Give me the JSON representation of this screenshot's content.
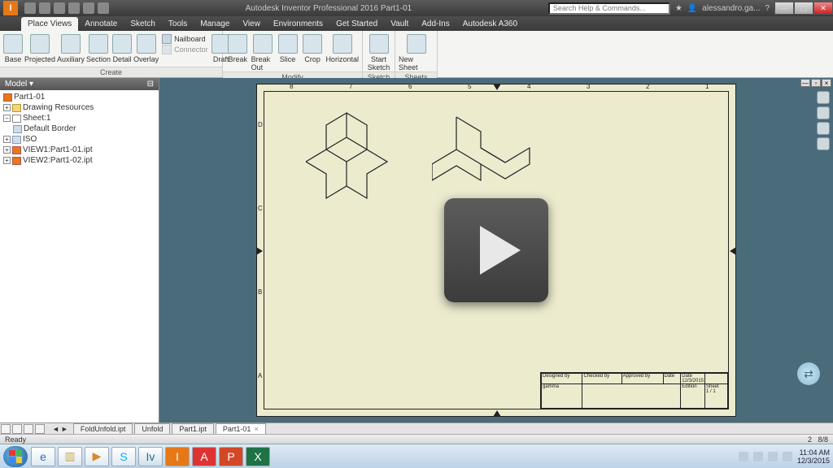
{
  "title": "Autodesk Inventor Professional 2016   Part1-01",
  "search_placeholder": "Search Help & Commands...",
  "user": "alessandro.ga...",
  "tabs": [
    "Place Views",
    "Annotate",
    "Sketch",
    "Tools",
    "Manage",
    "View",
    "Environments",
    "Get Started",
    "Vault",
    "Add-Ins",
    "Autodesk A360"
  ],
  "active_tab": 0,
  "ribbon": {
    "create": {
      "label": "Create",
      "big": [
        "Base",
        "Projected",
        "Auxiliary",
        "Section",
        "Detail",
        "Overlay"
      ],
      "side": [
        "Nailboard",
        "Connector"
      ],
      "draft": "Draft"
    },
    "modify": {
      "label": "Modify",
      "big": [
        "Break",
        "Break Out",
        "Slice",
        "Crop"
      ],
      "horizontal": "Horizontal"
    },
    "sketch": {
      "label": "Sketch",
      "btn": "Start\nSketch"
    },
    "sheets": {
      "label": "Sheets",
      "btn": "New Sheet"
    }
  },
  "browser": {
    "title": "Model ▾",
    "root": "Part1-01",
    "nodes": [
      {
        "label": "Drawing Resources",
        "icon": "folder",
        "indent": 1,
        "exp": "+"
      },
      {
        "label": "Sheet:1",
        "icon": "sheet",
        "indent": 1,
        "exp": "−"
      },
      {
        "label": "Default Border",
        "icon": "border",
        "indent": 2,
        "exp": ""
      },
      {
        "label": "ISO",
        "icon": "border",
        "indent": 2,
        "exp": "+"
      },
      {
        "label": "VIEW1:Part1-01.ipt",
        "icon": "part",
        "indent": 2,
        "exp": "+"
      },
      {
        "label": "VIEW2:Part1-02.ipt",
        "icon": "part",
        "indent": 2,
        "exp": "+"
      }
    ]
  },
  "sheet": {
    "cols": [
      "1",
      "2",
      "3",
      "4",
      "5",
      "6",
      "7",
      "8"
    ],
    "rows": [
      "A",
      "B",
      "C",
      "D"
    ],
    "tb": {
      "designed": "Designed by",
      "checked": "Checked by",
      "approved": "Approved by",
      "date": "Date",
      "date_val": "12/3/2015",
      "edition": "Edition",
      "sheet": "Sheet",
      "sheet_val": "1 / 1",
      "author": "gamma"
    }
  },
  "doctabs": [
    "FoldUnfold.ipt",
    "Unfold",
    "Part1.ipt",
    "Part1-01"
  ],
  "active_doctab": 3,
  "status": {
    "left": "Ready",
    "right_a": "2",
    "right_b": "8/8"
  },
  "tray": {
    "time": "11:04 AM",
    "date": "12/3/2015"
  },
  "taskbar_icons": [
    "ie",
    "files",
    "media",
    "skype",
    "inventor",
    "max",
    "acad",
    "ppt",
    "excel"
  ]
}
